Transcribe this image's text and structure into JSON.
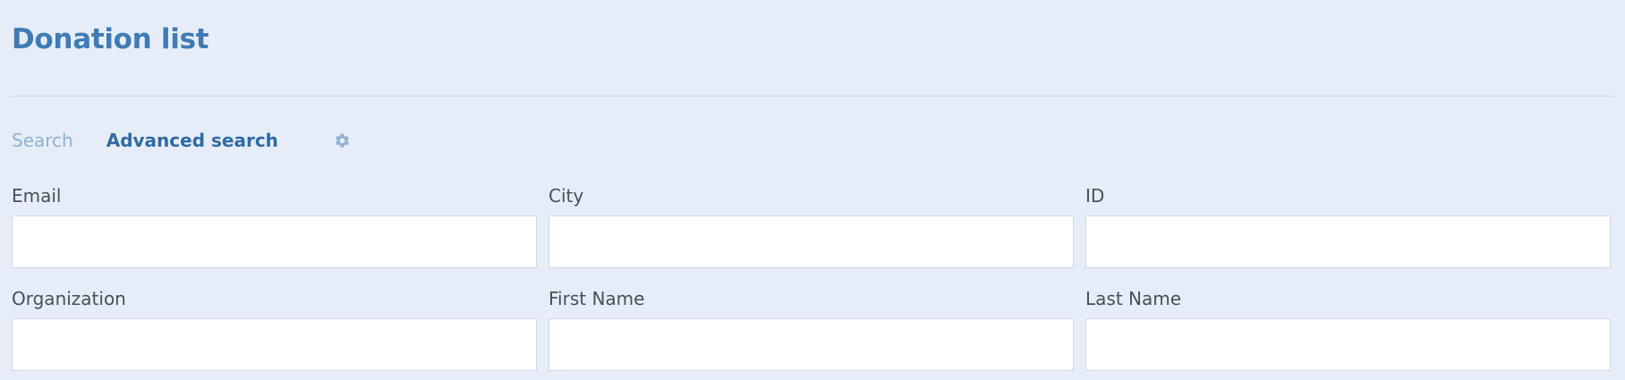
{
  "header": {
    "title": "Donation list"
  },
  "tabs": {
    "search_label": "Search",
    "advanced_label": "Advanced search",
    "settings_icon": "gear-icon"
  },
  "colors": {
    "title": "#3f7cb6",
    "background": "#e7edf8",
    "tab_inactive": "#8fb1d6",
    "tab_active": "#2f6aa4",
    "gear": "#8fb1d6"
  },
  "form": {
    "fields": [
      {
        "label": "Email",
        "value": "",
        "placeholder": ""
      },
      {
        "label": "City",
        "value": "",
        "placeholder": ""
      },
      {
        "label": "ID",
        "value": "",
        "placeholder": ""
      },
      {
        "label": "Organization",
        "value": "",
        "placeholder": ""
      },
      {
        "label": "First Name",
        "value": "",
        "placeholder": ""
      },
      {
        "label": "Last Name",
        "value": "",
        "placeholder": ""
      }
    ]
  }
}
